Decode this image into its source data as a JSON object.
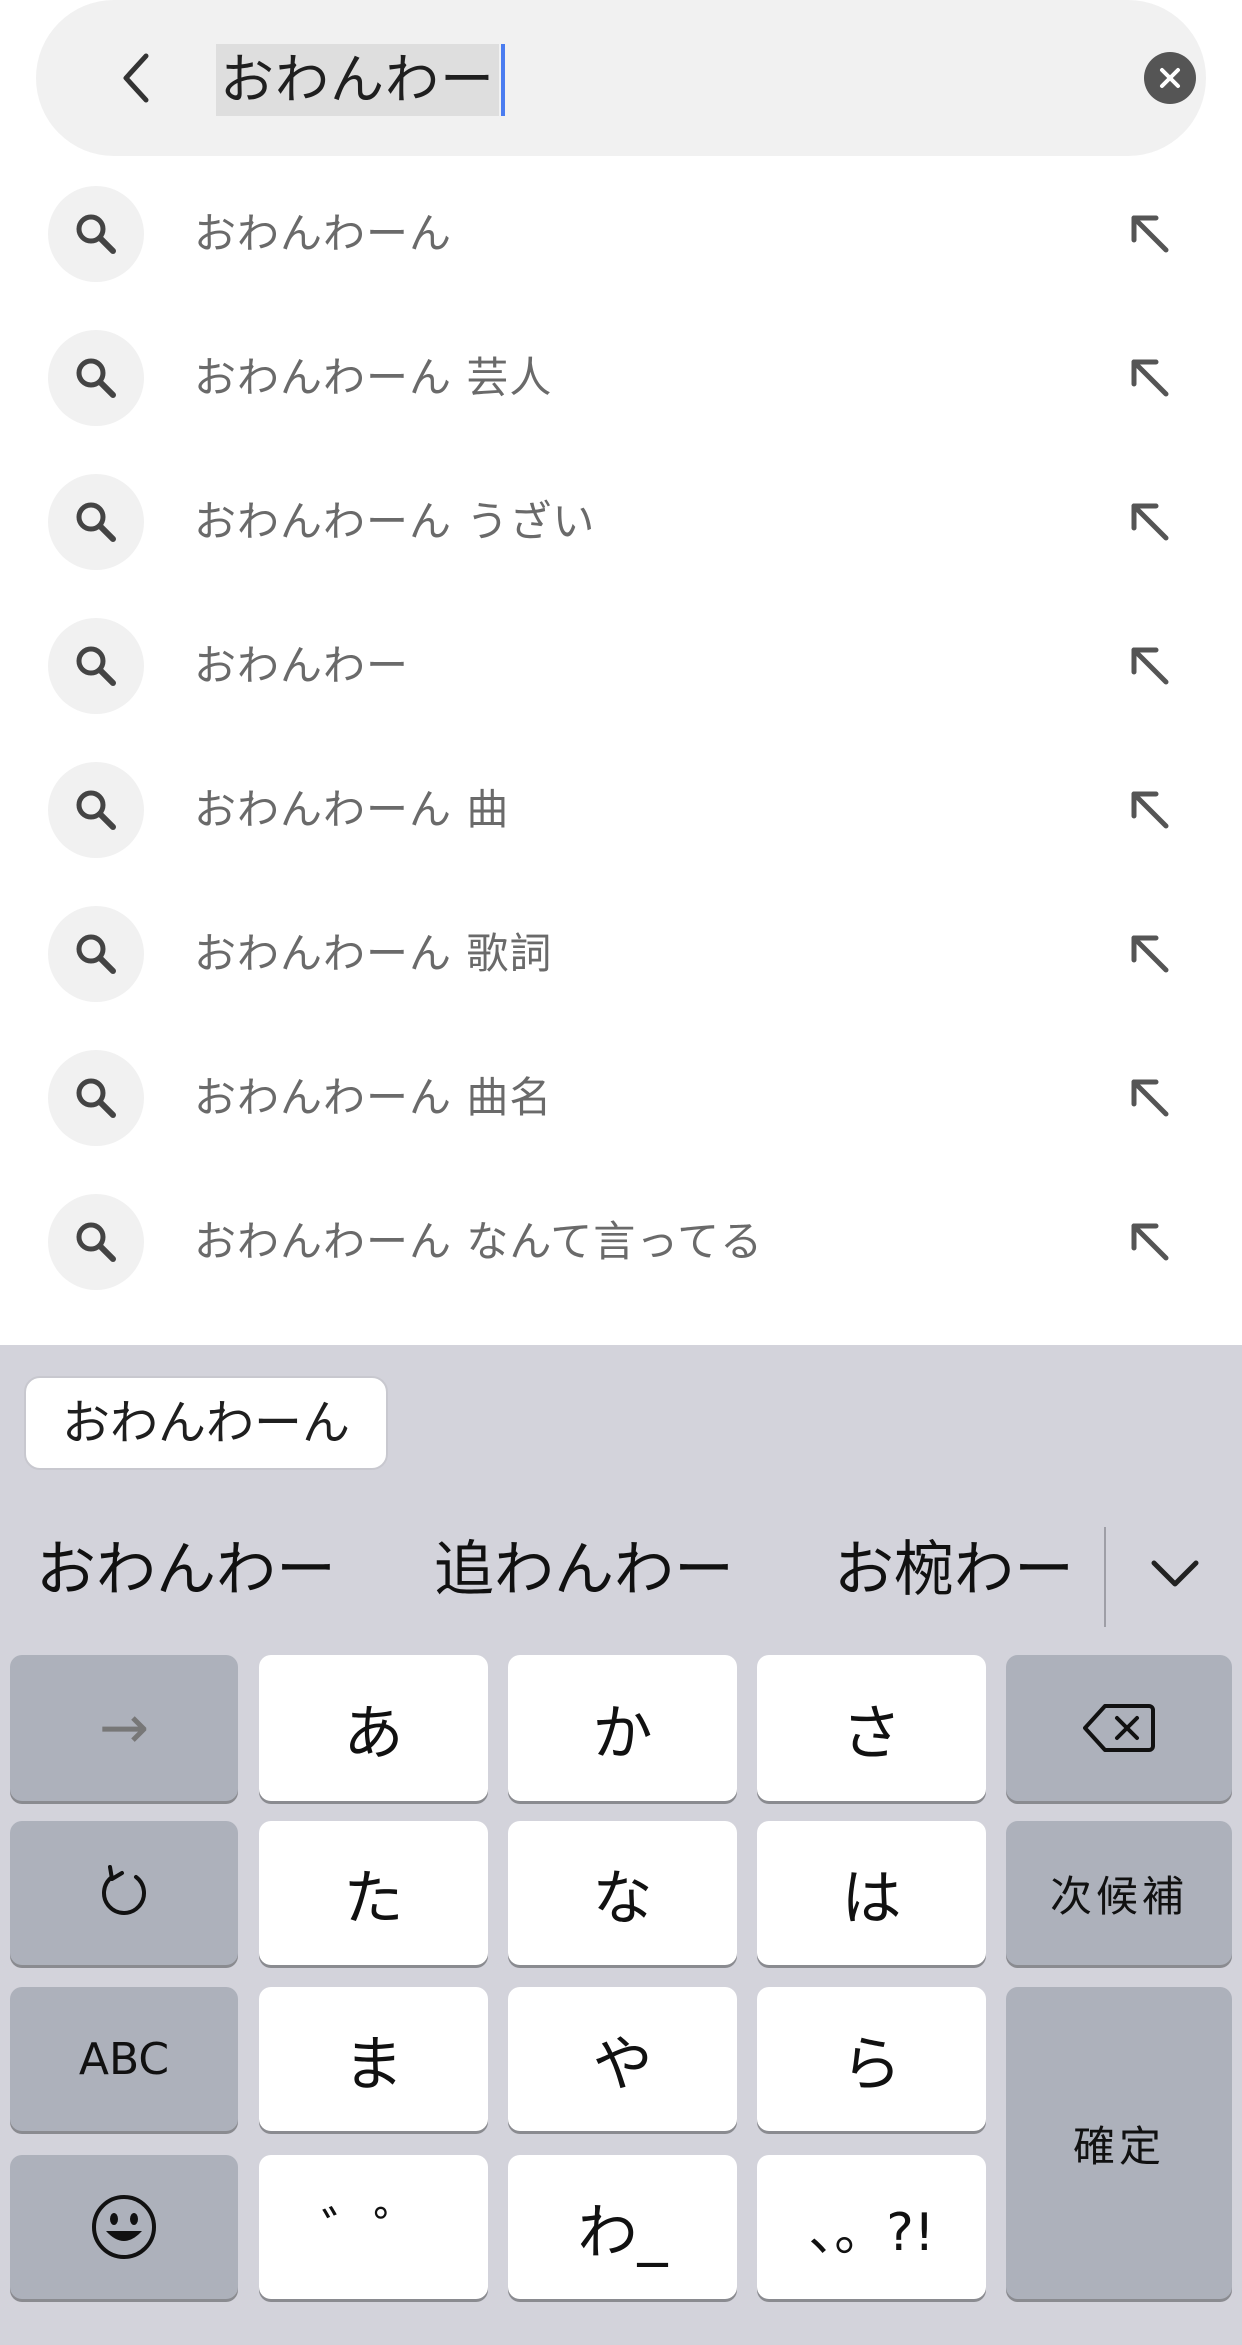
{
  "search": {
    "query": "おわんわー",
    "back_icon": "chevron-left-icon",
    "clear_icon": "clear-x-icon"
  },
  "suggestions": [
    {
      "text": "おわんわーん"
    },
    {
      "text": "おわんわーん 芸人"
    },
    {
      "text": "おわんわーん うざい"
    },
    {
      "text": "おわんわー"
    },
    {
      "text": "おわんわーん 曲"
    },
    {
      "text": "おわんわーん 歌詞"
    },
    {
      "text": "おわんわーん 曲名"
    },
    {
      "text": "おわんわーん なんて言ってる"
    }
  ],
  "keyboard": {
    "live_candidate": "おわんわーん",
    "candidates": [
      "おわんわー",
      "追わんわー",
      "お椀わー"
    ],
    "keys": {
      "arrow": "→",
      "a": "あ",
      "ka": "か",
      "sa": "さ",
      "ta": "た",
      "na": "な",
      "ha": "は",
      "next_candidate": "次候補",
      "abc": "ABC",
      "ma": "ま",
      "ya": "や",
      "ra": "ら",
      "confirm": "確定",
      "dakuten": "゛゜",
      "wa": "わ_",
      "punct": "、。?!"
    }
  }
}
